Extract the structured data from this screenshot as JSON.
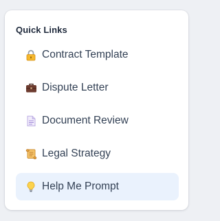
{
  "quick_links": {
    "title": "Quick Links",
    "items": [
      {
        "label": "Contract Template",
        "icon": "lock-icon",
        "active": false
      },
      {
        "label": "Dispute Letter",
        "icon": "briefcase-icon",
        "active": false
      },
      {
        "label": "Document Review",
        "icon": "document-icon",
        "active": false
      },
      {
        "label": "Legal Strategy",
        "icon": "scroll-icon",
        "active": false
      },
      {
        "label": "Help Me Prompt",
        "icon": "lightbulb-icon",
        "active": true
      }
    ]
  },
  "colors": {
    "card_background": "#ffffff",
    "page_background": "#eef0f4",
    "active_item_background": "#eaf2fd",
    "title_text": "#1e293b",
    "item_text": "#334155"
  }
}
